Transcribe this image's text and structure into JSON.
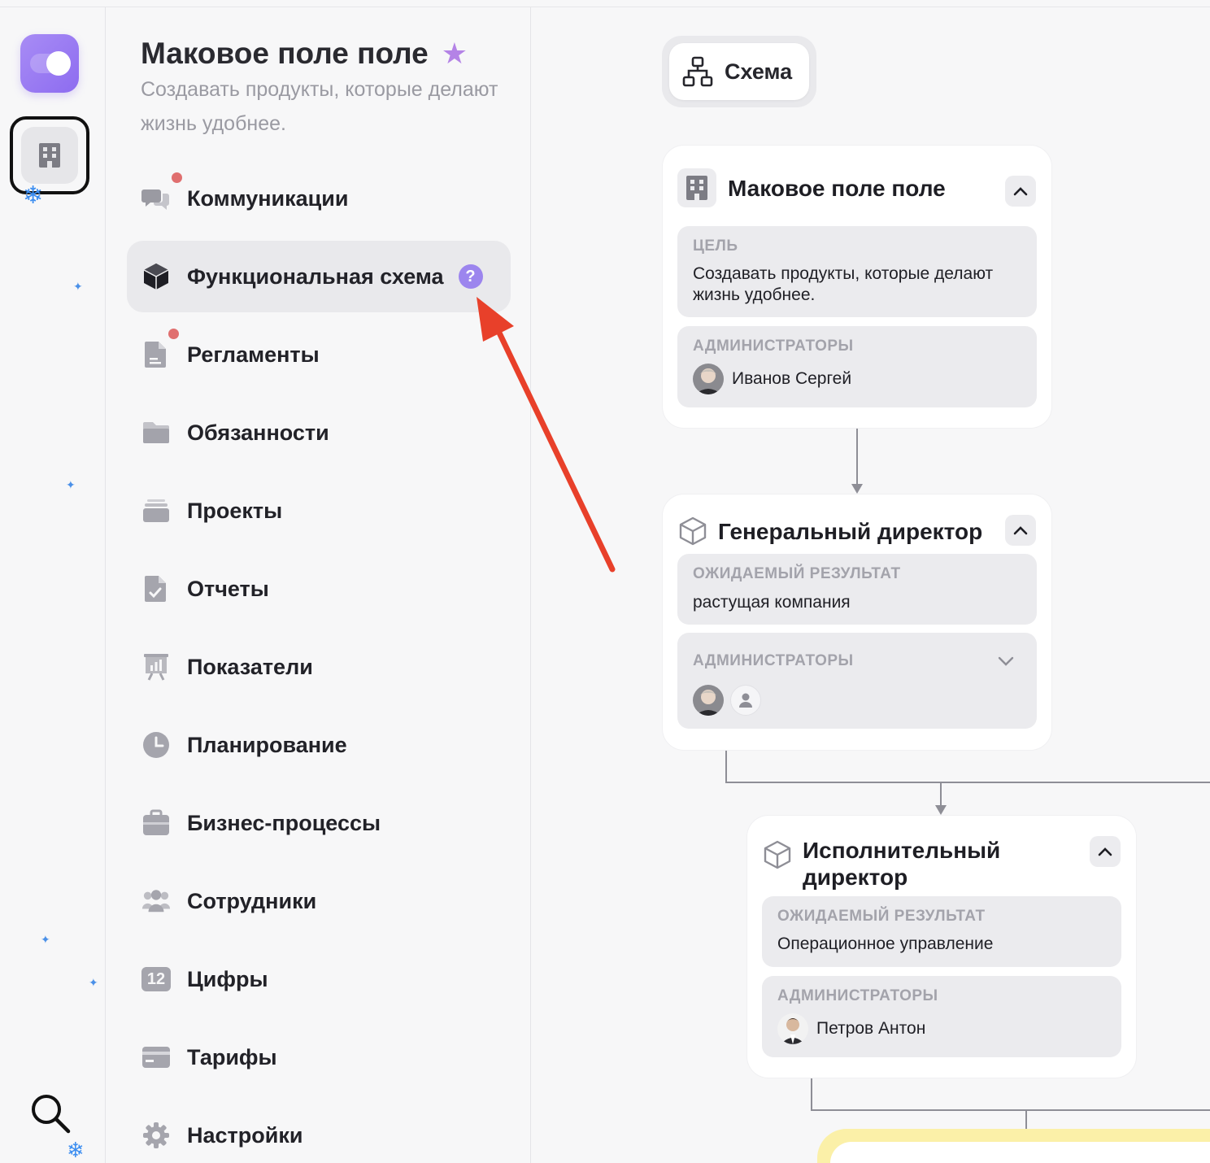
{
  "org": {
    "title": "Маковое поле поле",
    "goal": "Создавать продукты, которые делают жизнь удобнее."
  },
  "rail": {
    "app_icon": "toggle-icon",
    "org_icon": "building-icon",
    "search_icon": "search-icon"
  },
  "nav": [
    {
      "id": "communications",
      "label": "Коммуникации",
      "icon": "chat-icon",
      "unread": true
    },
    {
      "id": "functional-schema",
      "label": "Функциональная схема",
      "icon": "cube-icon",
      "active": true,
      "help": "?"
    },
    {
      "id": "regulations",
      "label": "Регламенты",
      "icon": "document-icon",
      "unread": true
    },
    {
      "id": "duties",
      "label": "Обязанности",
      "icon": "folder-icon"
    },
    {
      "id": "projects",
      "label": "Проекты",
      "icon": "stack-icon"
    },
    {
      "id": "reports",
      "label": "Отчеты",
      "icon": "report-check-icon"
    },
    {
      "id": "metrics",
      "label": "Показатели",
      "icon": "chart-board-icon"
    },
    {
      "id": "planning",
      "label": "Планирование",
      "icon": "clock-icon"
    },
    {
      "id": "business-processes",
      "label": "Бизнес-процессы",
      "icon": "briefcase-icon"
    },
    {
      "id": "employees",
      "label": "Сотрудники",
      "icon": "people-icon"
    },
    {
      "id": "numbers",
      "label": "Цифры",
      "icon": "number-12-icon",
      "icon_text": "12"
    },
    {
      "id": "tariffs",
      "label": "Тарифы",
      "icon": "card-icon"
    },
    {
      "id": "settings",
      "label": "Настройки",
      "icon": "gear-icon"
    }
  ],
  "schema_button": {
    "label": "Схема",
    "icon": "hierarchy-icon"
  },
  "cards": [
    {
      "title": "Маковое поле поле",
      "icon": "building-icon",
      "field1_caption": "ЦЕЛЬ",
      "field1_value": "Создавать продукты, которые делают жизнь удобнее.",
      "field2_caption": "АДМИНИСТРАТОРЫ",
      "admin_name": "Иванов Сергей"
    },
    {
      "title": "Генеральный директор",
      "icon": "cube-outline-icon",
      "field1_caption": "ОЖИДАЕМЫЙ РЕЗУЛЬТАТ",
      "field1_value": "растущая компания",
      "field2_caption": "АДМИНИСТРАТОРЫ"
    },
    {
      "title": "Исполнительный директор",
      "icon": "cube-outline-icon",
      "field1_caption": "ОЖИДАЕМЫЙ РЕЗУЛЬТАТ",
      "field1_value": "Операционное управление",
      "field2_caption": "АДМИНИСТРАТОРЫ",
      "admin_name": "Петров Антон"
    }
  ],
  "colors": {
    "accent": "#9c85ee",
    "unread_dot": "#e06f6f",
    "annotation_arrow": "#e8402a",
    "next_card_border": "#fbf0a8"
  }
}
